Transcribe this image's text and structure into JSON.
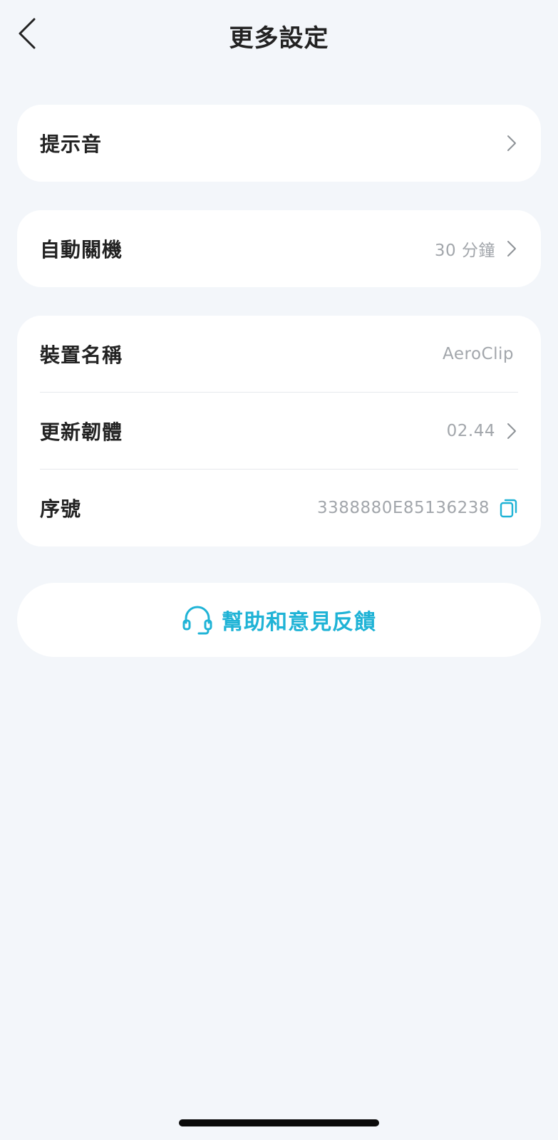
{
  "header": {
    "title": "更多設定",
    "back_icon": "chevron-left-icon"
  },
  "sections": {
    "sound": {
      "label": "提示音",
      "icon": "chevron-right-icon"
    },
    "auto_off": {
      "label": "自動關機",
      "value": "30 分鐘",
      "icon": "chevron-right-icon"
    },
    "device": {
      "name_label": "裝置名稱",
      "name_value": "AeroClip",
      "firmware_label": "更新韌體",
      "firmware_value": "02.44",
      "serial_label": "序號",
      "serial_value": "3388880E85136238",
      "copy_icon": "copy-icon"
    }
  },
  "help": {
    "label": "幫助和意見反饋",
    "icon": "headset-icon"
  },
  "colors": {
    "background": "#f3f6fa",
    "card": "#ffffff",
    "accent": "#1fb3d6",
    "muted_text": "#a2a6ab"
  }
}
